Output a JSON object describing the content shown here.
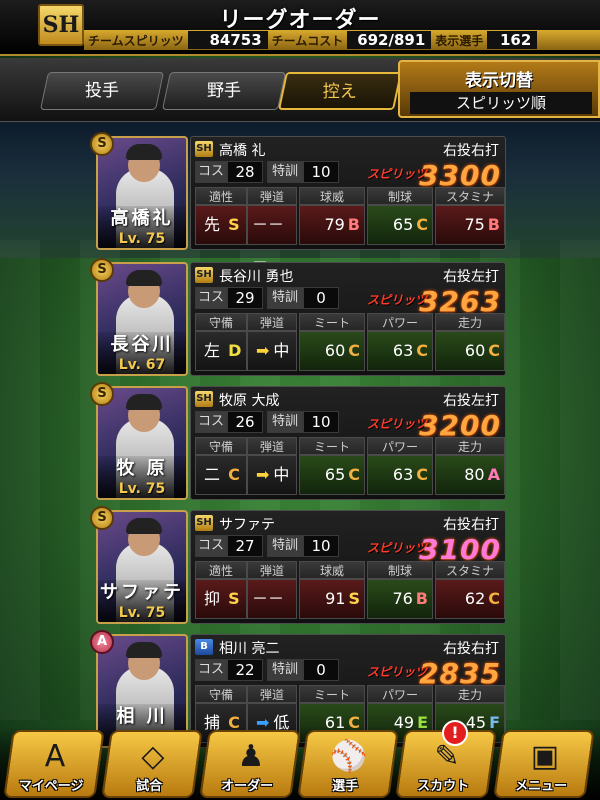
{
  "header": {
    "logo_text": "SH",
    "title": "リーグオーダー",
    "team_spirits_label": "チームスピリッツ",
    "team_spirits_value": "84753",
    "team_cost_label": "チームコスト",
    "team_cost_value": "692/891",
    "shown_players_label": "表示選手",
    "shown_players_value": "162"
  },
  "tabs": [
    {
      "label": "投手",
      "active": false
    },
    {
      "label": "野手",
      "active": false
    },
    {
      "label": "控え",
      "active": true
    }
  ],
  "display_switch": {
    "title": "表示切替",
    "value": "スピリッツ順"
  },
  "labels": {
    "cost": "コス",
    "special": "特訓",
    "spirits": "スピリッツ",
    "tekisei": "適性",
    "dando": "弾道",
    "kyui": "球威",
    "seikyu": "制球",
    "stamina": "スタミナ",
    "shubi": "守備",
    "meet": "ミート",
    "power": "パワー",
    "soryoku": "走力",
    "dashes": "－－－"
  },
  "players": [
    {
      "rank": "S",
      "team_badge": "SH",
      "short_name": "高橋礼",
      "level": "Lv. 75",
      "full_name": "高橋 礼",
      "hands": "右投右打",
      "cost": "28",
      "special": "10",
      "spirits": "3300",
      "spirits_color": "#ffa640",
      "type": "pitcher",
      "aptitude": "先",
      "aptitude_grade": "S",
      "trajectory": "－－－",
      "v1": "79",
      "g1": "B",
      "v2": "65",
      "g2": "C",
      "v3": "75",
      "g3": "B"
    },
    {
      "rank": "S",
      "team_badge": "SH",
      "short_name": "長谷川",
      "level": "Lv. 67",
      "full_name": "長谷川 勇也",
      "hands": "右投左打",
      "cost": "29",
      "special": "0",
      "spirits": "3263",
      "spirits_color": "#ffa640",
      "type": "batter",
      "position": "左",
      "position_grade": "D",
      "trajectory": "中",
      "v1": "60",
      "g1": "C",
      "v2": "63",
      "g2": "C",
      "v3": "60",
      "g3": "C"
    },
    {
      "rank": "S",
      "team_badge": "SH",
      "short_name": "牧 原",
      "level": "Lv. 75",
      "full_name": "牧原 大成",
      "hands": "右投左打",
      "cost": "26",
      "special": "10",
      "spirits": "3200",
      "spirits_color": "#ffa640",
      "type": "batter",
      "position": "二",
      "position_grade": "C",
      "trajectory": "中",
      "v1": "65",
      "g1": "C",
      "v2": "63",
      "g2": "C",
      "v3": "80",
      "g3": "A"
    },
    {
      "rank": "S",
      "team_badge": "SH",
      "short_name": "サファテ",
      "level": "Lv. 75",
      "full_name": "サファテ",
      "hands": "右投右打",
      "cost": "27",
      "special": "10",
      "spirits": "3100",
      "spirits_color": "#ff7ad6",
      "type": "pitcher",
      "aptitude": "抑",
      "aptitude_grade": "S",
      "trajectory": "－－－",
      "v1": "91",
      "g1": "S",
      "v2": "76",
      "g2": "B",
      "v3": "62",
      "g3": "C"
    },
    {
      "rank": "A",
      "team_badge": "B",
      "short_name": "相 川",
      "level": "",
      "full_name": "相川 亮二",
      "hands": "右投右打",
      "cost": "22",
      "special": "0",
      "spirits": "2835",
      "spirits_color": "#ffa640",
      "type": "batter",
      "position": "捕",
      "position_grade": "C",
      "trajectory": "低",
      "v1": "61",
      "g1": "C",
      "v2": "49",
      "g2": "E",
      "v3": "45",
      "g3": "F"
    }
  ],
  "nav": [
    {
      "label": "マイページ",
      "icon": "A"
    },
    {
      "label": "試合",
      "icon": "◇"
    },
    {
      "label": "オーダー",
      "icon": "♟"
    },
    {
      "label": "選手",
      "icon": "⚾"
    },
    {
      "label": "スカウト",
      "icon": "✎"
    },
    {
      "label": "メニュー",
      "icon": "▣"
    }
  ],
  "notification_badge": "!"
}
